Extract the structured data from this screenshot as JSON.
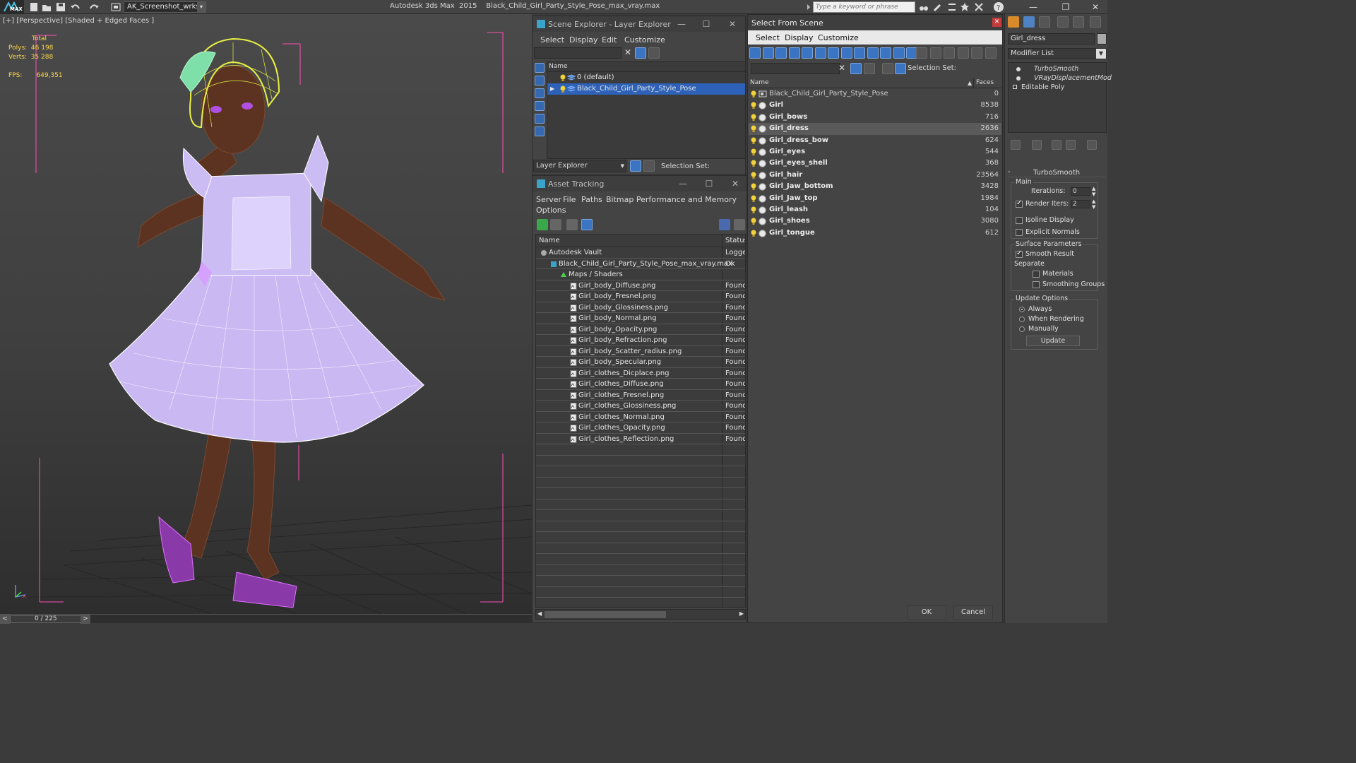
{
  "titlebar": {
    "logo_text": "MAX",
    "workspace": "AK_Screenshot_wrksp",
    "app_name": "Autodesk 3ds Max  2015",
    "file_name": "Black_Child_Girl_Party_Style_Pose_max_vray.max",
    "search_placeholder": "Type a keyword or phrase"
  },
  "viewport": {
    "label": "[+] [Perspective] [Shaded + Edged Faces ]",
    "stats": {
      "total_label": "Total",
      "polys_label": "Polys:",
      "polys_value": "46 198",
      "verts_label": "Verts:",
      "verts_value": "35 288",
      "fps_label": "FPS:",
      "fps_value": "649,351"
    }
  },
  "timeline": {
    "frame": "0 / 225",
    "prev": "<",
    "next": ">"
  },
  "scene_explorer": {
    "title": "Scene Explorer - Layer Explorer",
    "menu": [
      "Select",
      "Display",
      "Edit",
      "Customize"
    ],
    "column_name": "Name",
    "layers": [
      {
        "label": "0 (default)",
        "selected": false
      },
      {
        "label": "Black_Child_Girl_Party_Style_Pose",
        "selected": true
      }
    ],
    "explorer_dropdown": "Layer Explorer",
    "selection_set_label": "Selection Set:"
  },
  "asset_tracking": {
    "title": "Asset Tracking",
    "menu": [
      "Server",
      "File",
      "Paths",
      "Bitmap Performance and Memory"
    ],
    "menu2": [
      "Options"
    ],
    "col_name": "Name",
    "col_status": "Status",
    "rows": [
      {
        "name": "Autodesk Vault",
        "status": "Logged",
        "indent": 0,
        "icon": "vault"
      },
      {
        "name": "Black_Child_Girl_Party_Style_Pose_max_vray.max",
        "status": "Ok",
        "indent": 1,
        "icon": "max"
      },
      {
        "name": "Maps / Shaders",
        "status": "",
        "indent": 2,
        "icon": "maps"
      },
      {
        "name": "Girl_body_Diffuse.png",
        "status": "Found",
        "indent": 3,
        "icon": "file"
      },
      {
        "name": "Girl_body_Fresnel.png",
        "status": "Found",
        "indent": 3,
        "icon": "file"
      },
      {
        "name": "Girl_body_Glossiness.png",
        "status": "Found",
        "indent": 3,
        "icon": "file"
      },
      {
        "name": "Girl_body_Normal.png",
        "status": "Found",
        "indent": 3,
        "icon": "file"
      },
      {
        "name": "Girl_body_Opacity.png",
        "status": "Found",
        "indent": 3,
        "icon": "file"
      },
      {
        "name": "Girl_body_Refraction.png",
        "status": "Found",
        "indent": 3,
        "icon": "file"
      },
      {
        "name": "Girl_body_Scatter_radius.png",
        "status": "Found",
        "indent": 3,
        "icon": "file"
      },
      {
        "name": "Girl_body_Specular.png",
        "status": "Found",
        "indent": 3,
        "icon": "file"
      },
      {
        "name": "Girl_clothes_Dicplace.png",
        "status": "Found",
        "indent": 3,
        "icon": "file"
      },
      {
        "name": "Girl_clothes_Diffuse.png",
        "status": "Found",
        "indent": 3,
        "icon": "file"
      },
      {
        "name": "Girl_clothes_Fresnel.png",
        "status": "Found",
        "indent": 3,
        "icon": "file"
      },
      {
        "name": "Girl_clothes_Glossiness.png",
        "status": "Found",
        "indent": 3,
        "icon": "file"
      },
      {
        "name": "Girl_clothes_Normal.png",
        "status": "Found",
        "indent": 3,
        "icon": "file"
      },
      {
        "name": "Girl_clothes_Opacity.png",
        "status": "Found",
        "indent": 3,
        "icon": "file"
      },
      {
        "name": "Girl_clothes_Reflection.png",
        "status": "Found",
        "indent": 3,
        "icon": "file"
      }
    ]
  },
  "select_from_scene": {
    "title": "Select From Scene",
    "menu": [
      "Select",
      "Display",
      "Customize"
    ],
    "selection_set_label": "Selection Set:",
    "col_name": "Name",
    "col_faces": "Faces",
    "rows": [
      {
        "name": "Black_Child_Girl_Party_Style_Pose",
        "faces": "0",
        "selected": false,
        "group": true
      },
      {
        "name": "Girl",
        "faces": "8538",
        "selected": false,
        "group": false
      },
      {
        "name": "Girl_bows",
        "faces": "716",
        "selected": false,
        "group": false
      },
      {
        "name": "Girl_dress",
        "faces": "2636",
        "selected": true,
        "group": false
      },
      {
        "name": "Girl_dress_bow",
        "faces": "624",
        "selected": false,
        "group": false
      },
      {
        "name": "Girl_eyes",
        "faces": "544",
        "selected": false,
        "group": false
      },
      {
        "name": "Girl_eyes_shell",
        "faces": "368",
        "selected": false,
        "group": false
      },
      {
        "name": "Girl_hair",
        "faces": "23564",
        "selected": false,
        "group": false
      },
      {
        "name": "Girl_Jaw_bottom",
        "faces": "3428",
        "selected": false,
        "group": false
      },
      {
        "name": "Girl_Jaw_top",
        "faces": "1984",
        "selected": false,
        "group": false
      },
      {
        "name": "Girl_leash",
        "faces": "104",
        "selected": false,
        "group": false
      },
      {
        "name": "Girl_shoes",
        "faces": "3080",
        "selected": false,
        "group": false
      },
      {
        "name": "Girl_tongue",
        "faces": "612",
        "selected": false,
        "group": false
      }
    ],
    "ok_label": "OK",
    "cancel_label": "Cancel"
  },
  "command_panel": {
    "object_name": "Girl_dress",
    "object_color": "#a9a9a9",
    "modifier_list": "Modifier List",
    "stack": [
      "TurboSmooth",
      "VRayDisplacementMod",
      "Editable Poly"
    ],
    "rollout_title": "TurboSmooth",
    "main_label": "Main",
    "iterations_label": "Iterations:",
    "iterations_value": "0",
    "render_iters_label": "Render Iters:",
    "render_iters_value": "2",
    "render_iters_checked": true,
    "isoline_label": "Isoline Display",
    "explicit_normals_label": "Explicit Normals",
    "surface_params_label": "Surface Parameters",
    "smooth_result_label": "Smooth Result",
    "separate_label": "Separate",
    "materials_label": "Materials",
    "smoothing_groups_label": "Smoothing Groups",
    "update_options_label": "Update Options",
    "always_label": "Always",
    "when_rendering_label": "When Rendering",
    "manually_label": "Manually",
    "update_button": "Update"
  },
  "colors": {
    "selection_blue": "#2e62b8",
    "dress": "#c9b8f2",
    "skin": "#6a3b24",
    "hair_wire": "#e8f043",
    "shoes": "#c050e0"
  }
}
